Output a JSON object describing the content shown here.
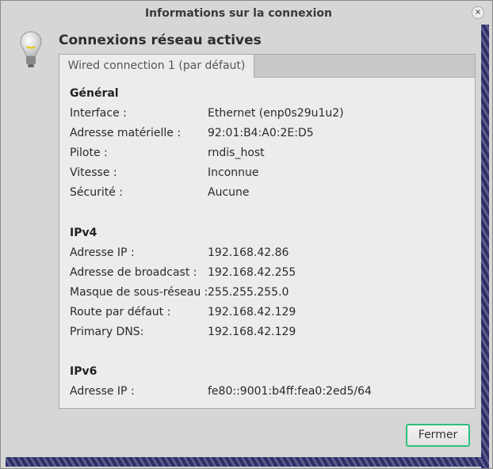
{
  "window": {
    "title": "Informations sur la connexion"
  },
  "heading": "Connexions réseau actives",
  "tab": "Wired connection 1 (par défaut)",
  "sections": [
    {
      "title": "Général",
      "rows": [
        {
          "k": "Interface :",
          "v": "Ethernet (enp0s29u1u2)"
        },
        {
          "k": "Adresse matérielle :",
          "v": "92:01:B4:A0:2E:D5"
        },
        {
          "k": "Pilote :",
          "v": "rndis_host"
        },
        {
          "k": "Vitesse :",
          "v": "Inconnue"
        },
        {
          "k": "Sécurité :",
          "v": "Aucune"
        }
      ]
    },
    {
      "title": "IPv4",
      "rows": [
        {
          "k": "Adresse IP :",
          "v": "192.168.42.86"
        },
        {
          "k": "Adresse de broadcast :",
          "v": "192.168.42.255"
        },
        {
          "k": "Masque de sous-réseau :",
          "v": "255.255.255.0"
        },
        {
          "k": "Route par défaut :",
          "v": "192.168.42.129"
        },
        {
          "k": "Primary DNS:",
          "v": "192.168.42.129"
        }
      ]
    },
    {
      "title": "IPv6",
      "rows": [
        {
          "k": "Adresse IP :",
          "v": "fe80::9001:b4ff:fea0:2ed5/64"
        }
      ]
    }
  ],
  "close_button": "Fermer",
  "close_icon": "×"
}
